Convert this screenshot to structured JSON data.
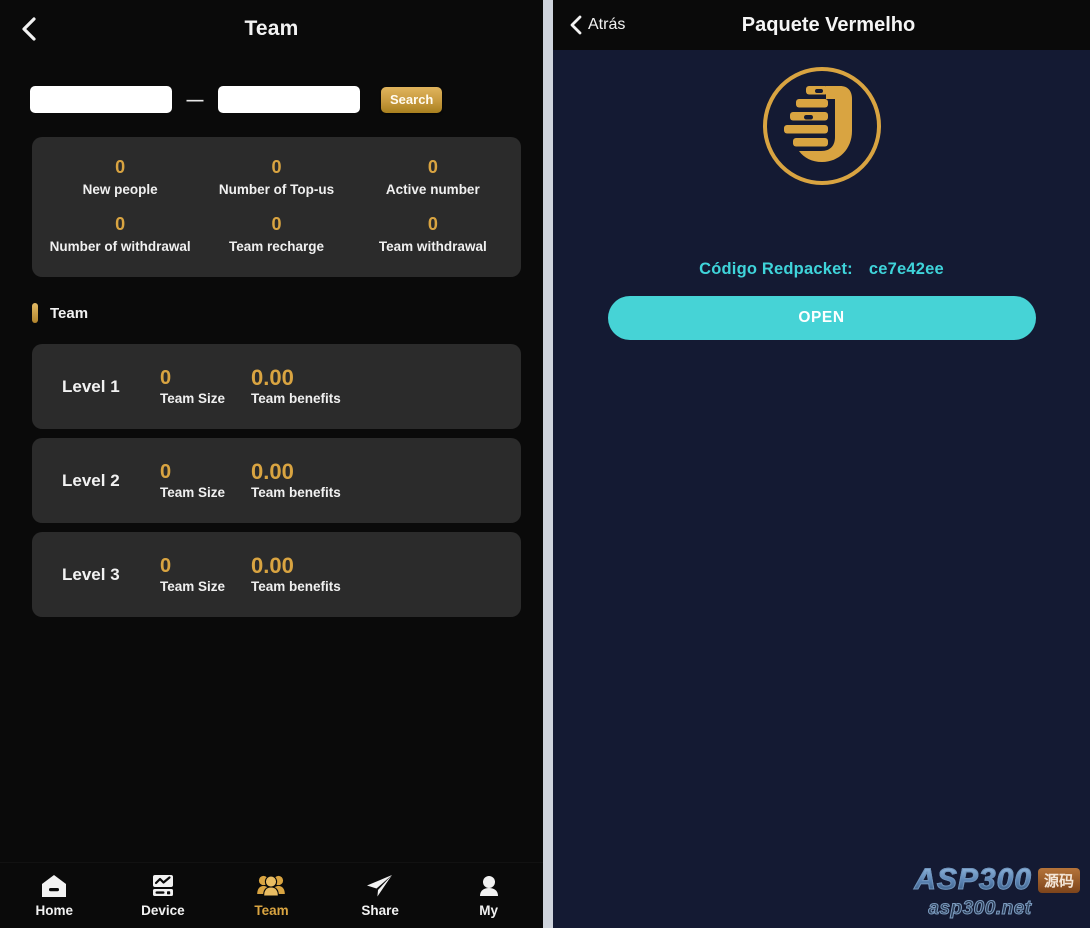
{
  "left": {
    "header": {
      "title": "Team",
      "back_icon": "chevron-left-icon"
    },
    "search": {
      "input_start_value": "",
      "input_start_placeholder": "",
      "separator": "—",
      "input_end_value": "",
      "input_end_placeholder": "",
      "button_label": "Search"
    },
    "stats": [
      {
        "value": "0",
        "label": "New people"
      },
      {
        "value": "0",
        "label": "Number of Top-us"
      },
      {
        "value": "0",
        "label": "Active number"
      },
      {
        "value": "0",
        "label": "Number of withdrawal"
      },
      {
        "value": "0",
        "label": "Team recharge"
      },
      {
        "value": "0",
        "label": "Team withdrawal"
      }
    ],
    "section_title": "Team",
    "levels": [
      {
        "name": "Level 1",
        "size_value": "0",
        "size_label": "Team Size",
        "benefits_value": "0.00",
        "benefits_label": "Team benefits"
      },
      {
        "name": "Level 2",
        "size_value": "0",
        "size_label": "Team Size",
        "benefits_value": "0.00",
        "benefits_label": "Team benefits"
      },
      {
        "name": "Level 3",
        "size_value": "0",
        "size_label": "Team Size",
        "benefits_value": "0.00",
        "benefits_label": "Team benefits"
      }
    ],
    "nav": [
      {
        "label": "Home",
        "icon": "home-icon",
        "active": false
      },
      {
        "label": "Device",
        "icon": "device-icon",
        "active": false
      },
      {
        "label": "Team",
        "icon": "team-icon",
        "active": true
      },
      {
        "label": "Share",
        "icon": "share-paper-plane-icon",
        "active": false
      },
      {
        "label": "My",
        "icon": "user-icon",
        "active": false
      }
    ]
  },
  "right": {
    "header": {
      "back_label": "Atrás",
      "back_icon": "chevron-left-icon",
      "title": "Paquete Vermelho"
    },
    "logo_icon": "brand-u-circle-logo",
    "code_label": "Código Redpacket:",
    "code_value": "ce7e42ee",
    "open_button_label": "OPEN",
    "watermark": {
      "main": "ASP300",
      "badge": "源码",
      "sub": "asp300.net"
    }
  },
  "colors": {
    "gold": "#d9a441",
    "card_bg": "#2b2b2b",
    "page_bg": "#0a0a0a",
    "navy_bg": "#141a33",
    "turquoise": "#46d3d6",
    "code_cyan": "#3fd4da"
  }
}
